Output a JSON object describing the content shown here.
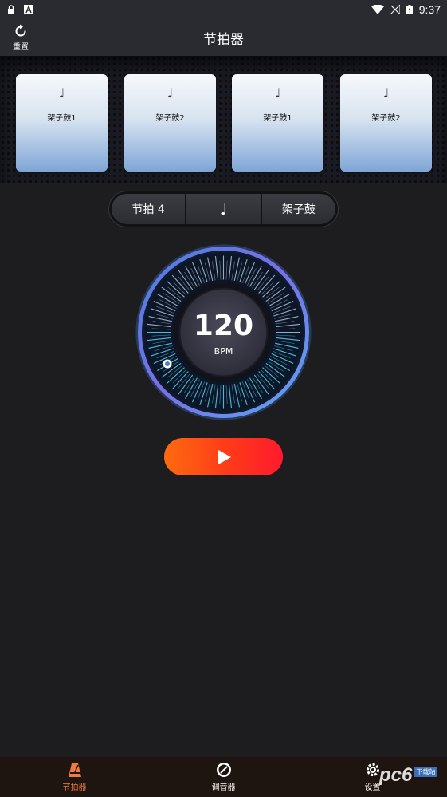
{
  "status_bar": {
    "time": "9:37"
  },
  "header": {
    "title": "节拍器",
    "reset_label": "重置"
  },
  "pattern": {
    "cards": [
      {
        "note": "♩",
        "drum": "架子鼓1"
      },
      {
        "note": "♩",
        "drum": "架子鼓2"
      },
      {
        "note": "♩",
        "drum": "架子鼓1"
      },
      {
        "note": "♩",
        "drum": "架子鼓2"
      }
    ]
  },
  "selector": {
    "beats": "节拍 4",
    "note": "♩",
    "sound": "架子鼓"
  },
  "dial": {
    "bpm": "120",
    "unit": "BPM"
  },
  "nav": {
    "items": [
      {
        "label": "节拍器",
        "icon": "metronome-icon",
        "active": true
      },
      {
        "label": "调音器",
        "icon": "tuner-icon",
        "active": false
      },
      {
        "label": "设置",
        "icon": "gear-icon",
        "active": false
      }
    ]
  },
  "watermark": {
    "text": "pc6",
    "tag": "下载站"
  },
  "colors": {
    "accent": "#f07a40",
    "play_start": "#ff6a10",
    "play_end": "#ff1a2c",
    "dial_ring": "#5aa8f0"
  }
}
